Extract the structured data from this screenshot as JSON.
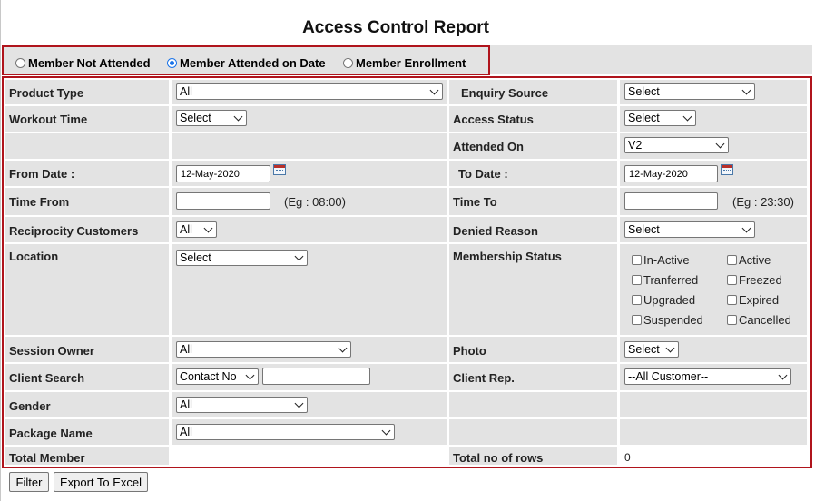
{
  "title": "Access Control Report",
  "report_mode": {
    "options": [
      "Member Not Attended",
      "Member Attended on Date",
      "Member Enrollment"
    ],
    "selected": "Member Attended on Date"
  },
  "filters": {
    "product_type": {
      "label": "Product Type",
      "value": "All"
    },
    "enquiry_source": {
      "label": "Enquiry Source",
      "value": "Select"
    },
    "workout_time": {
      "label": "Workout Time",
      "value": "Select"
    },
    "access_status": {
      "label": "Access Status",
      "value": "Select"
    },
    "attended_on": {
      "label": "Attended On",
      "value": "V2"
    },
    "from_date": {
      "label": "From Date  :",
      "value": "12-May-2020"
    },
    "to_date": {
      "label": "To  Date  :",
      "value": "12-May-2020"
    },
    "time_from": {
      "label": "Time From",
      "value": "",
      "hint": "(Eg : 08:00)"
    },
    "time_to": {
      "label": "Time To",
      "value": "",
      "hint": "(Eg : 23:30)"
    },
    "reciprocity_customers": {
      "label": "Reciprocity Customers",
      "value": "All"
    },
    "denied_reason": {
      "label": "Denied Reason",
      "value": "Select"
    },
    "location": {
      "label": "Location",
      "value": "Select"
    },
    "membership_status": {
      "label": "Membership Status",
      "options": [
        {
          "label": "In-Active",
          "checked": false
        },
        {
          "label": "Active",
          "checked": false
        },
        {
          "label": "Tranferred",
          "checked": false
        },
        {
          "label": "Freezed",
          "checked": false
        },
        {
          "label": "Upgraded",
          "checked": false
        },
        {
          "label": "Expired",
          "checked": false
        },
        {
          "label": "Suspended",
          "checked": false
        },
        {
          "label": "Cancelled",
          "checked": false
        }
      ]
    },
    "session_owner": {
      "label": "Session Owner",
      "value": "All"
    },
    "photo": {
      "label": "Photo",
      "value": "Select"
    },
    "client_search": {
      "label": "Client Search",
      "type_value": "Contact No",
      "value": ""
    },
    "client_rep": {
      "label": "Client Rep.",
      "value": "--All Customer--"
    },
    "gender": {
      "label": "Gender",
      "value": "All"
    },
    "package_name": {
      "label": "Package Name",
      "value": "All"
    },
    "total_member": {
      "label": "Total Member",
      "value": ""
    },
    "total_rows": {
      "label": "Total no of rows",
      "value": "0"
    }
  },
  "buttons": {
    "filter": "Filter",
    "export": "Export To Excel"
  },
  "colors": {
    "border_accent": "#b0141c",
    "cell_bg": "#e3e3e3",
    "radio_selected": "#1a73e8"
  }
}
